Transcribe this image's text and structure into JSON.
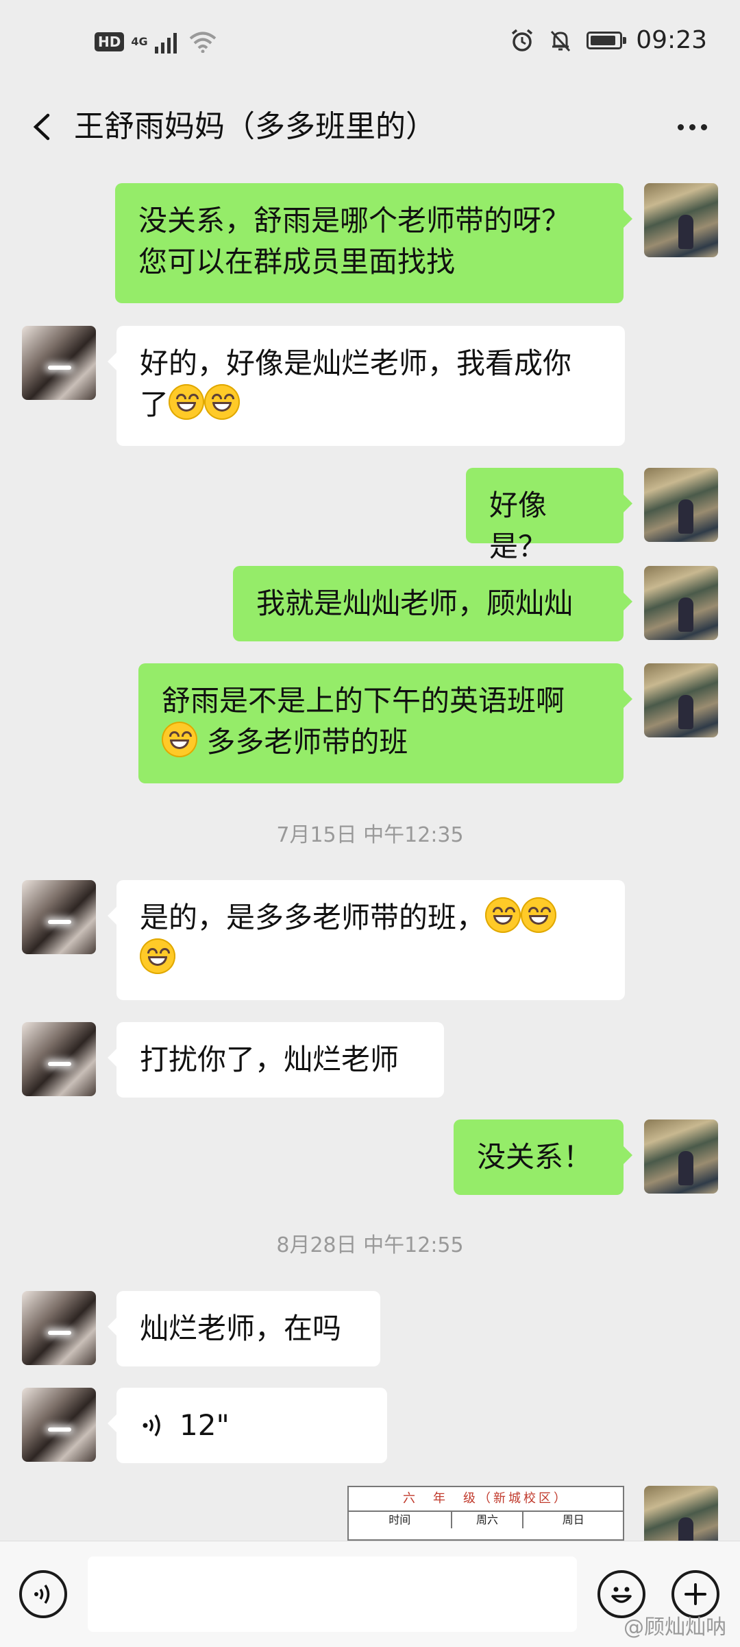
{
  "status": {
    "network": "4G",
    "hd": "HD",
    "time": "09:23",
    "battery_level": 0.9
  },
  "header": {
    "title": "王舒雨妈妈（多多班里的）"
  },
  "messages": {
    "m1": "没关系，舒雨是哪个老师带的呀？\n您可以在群成员里面找找",
    "m2a": "好的，好像是灿烂老师，我看成你\n了",
    "m3": "好像是？",
    "m4": "我就是灿灿老师，顾灿灿",
    "m5a": "舒雨是不是上的下午的英语班啊",
    "m5b": " 多多老师带的班",
    "m6a": "是的，是多多老师带的班，",
    "m7": "打扰你了，灿烂老师",
    "m8": "没关系！",
    "m9": "灿烂老师，在吗",
    "m10": "12\""
  },
  "timestamps": {
    "t1": "7月15日 中午12:35",
    "t2": "8月28日 中午12:55"
  },
  "doc": {
    "title": "六　年　级（新城校区）",
    "col1": "时间",
    "col2": "周六",
    "col3": "周日"
  },
  "watermark": "@顾灿灿呐",
  "icons": [
    "back-arrow-icon",
    "more-icon",
    "voice-toggle-icon",
    "emoji-icon",
    "plus-icon",
    "alarm-icon",
    "mute-icon",
    "wifi-icon",
    "signal-icon",
    "battery-icon",
    "voice-wave-icon"
  ]
}
